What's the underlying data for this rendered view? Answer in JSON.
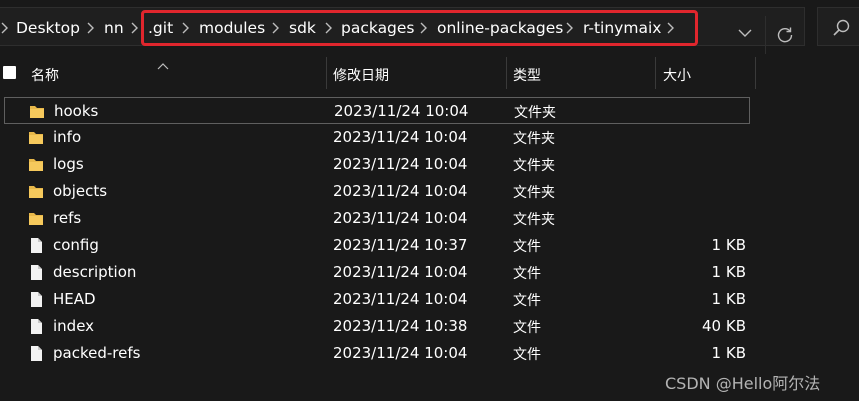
{
  "breadcrumb": {
    "items": [
      "Desktop",
      "nn",
      ".git",
      "modules",
      "sdk",
      "packages",
      "online-packages",
      "r-tinymaix"
    ]
  },
  "highlight_color": "#e0262d",
  "columns": {
    "name": "名称",
    "date": "修改日期",
    "type": "类型",
    "size": "大小"
  },
  "files": [
    {
      "name": "hooks",
      "date": "2023/11/24 10:04",
      "type": "文件夹",
      "size": "",
      "icon": "folder-icon"
    },
    {
      "name": "info",
      "date": "2023/11/24 10:04",
      "type": "文件夹",
      "size": "",
      "icon": "folder-icon"
    },
    {
      "name": "logs",
      "date": "2023/11/24 10:04",
      "type": "文件夹",
      "size": "",
      "icon": "folder-icon"
    },
    {
      "name": "objects",
      "date": "2023/11/24 10:04",
      "type": "文件夹",
      "size": "",
      "icon": "folder-icon"
    },
    {
      "name": "refs",
      "date": "2023/11/24 10:04",
      "type": "文件夹",
      "size": "",
      "icon": "folder-icon"
    },
    {
      "name": "config",
      "date": "2023/11/24 10:37",
      "type": "文件",
      "size": "1 KB",
      "icon": "file-icon"
    },
    {
      "name": "description",
      "date": "2023/11/24 10:04",
      "type": "文件",
      "size": "1 KB",
      "icon": "file-icon"
    },
    {
      "name": "HEAD",
      "date": "2023/11/24 10:04",
      "type": "文件",
      "size": "1 KB",
      "icon": "file-icon"
    },
    {
      "name": "index",
      "date": "2023/11/24 10:38",
      "type": "文件",
      "size": "40 KB",
      "icon": "file-icon"
    },
    {
      "name": "packed-refs",
      "date": "2023/11/24 10:04",
      "type": "文件",
      "size": "1 KB",
      "icon": "file-icon"
    }
  ],
  "watermark": "CSDN @Hello阿尔法"
}
